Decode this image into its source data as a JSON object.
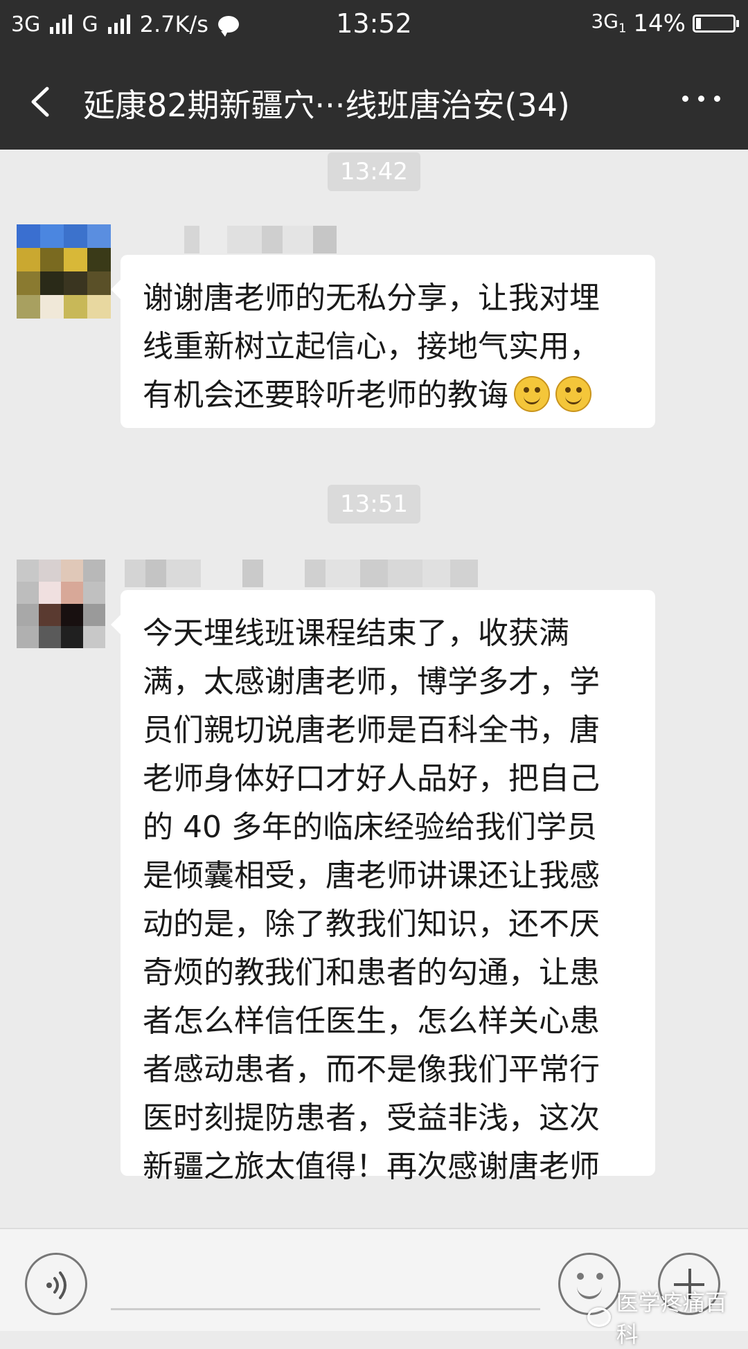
{
  "status_bar": {
    "network1": "3G",
    "network2": "G",
    "speed": "2.7K/s",
    "time": "13:52",
    "network3": "3G",
    "network3_sub": "1",
    "battery_percent": "14%",
    "battery_level": 0.14
  },
  "title_bar": {
    "title": "延康82期新疆穴···线班唐治安(34)",
    "back_icon": "chevron-left-icon",
    "more_icon": "more-dots-icon"
  },
  "messages": [
    {
      "timestamp": "13:42",
      "lines": [
        "谢谢唐老师的无私分享，让我对埋",
        "线重新树立起信心，接地气实用，",
        "有机会还要聆听老师的教诲"
      ],
      "emoji_count": 2,
      "emoji_name": "smiley-icon"
    },
    {
      "timestamp": "13:51",
      "lines": [
        "今天埋线班课程结束了，收获满",
        "满，太感谢唐老师，博学多才，学",
        "员们親切说唐老师是百科全书，唐",
        "老师身体好口才好人品好，把自己",
        "的 40 多年的临床经验给我们学员",
        "是倾囊相受，唐老师讲课还让我感",
        "动的是，除了教我们知识，还不厌",
        "奇烦的教我们和患者的勾通，让患",
        "者怎么样信任医生，怎么样关心患",
        "者感动患者，而不是像我们平常行",
        "医时刻提防患者，受益非浅，这次",
        "新疆之旅太值得！再次感谢唐老师"
      ]
    }
  ],
  "input_bar": {
    "voice_icon": "voice-icon",
    "emoji_icon": "emoji-icon",
    "plus_icon": "plus-icon"
  },
  "watermark": {
    "text": "医学疼痛百科",
    "icon": "wechat-icon"
  },
  "colors": {
    "header_bg": "#2e2e2e",
    "chat_bg": "#ebebeb",
    "bubble_bg": "#ffffff",
    "timestamp_bg": "#dadada"
  }
}
